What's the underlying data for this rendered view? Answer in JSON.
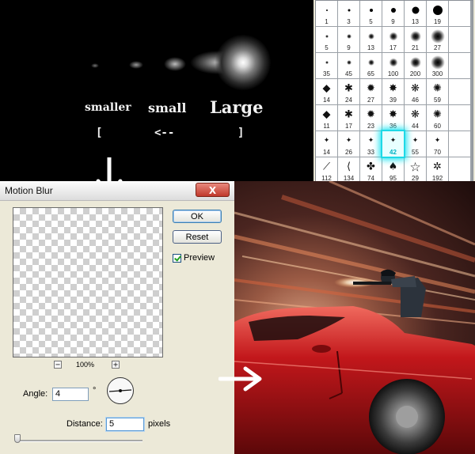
{
  "brush_tips": {
    "smaller_label": "smaller",
    "small_label": "small",
    "large_label": "Large",
    "key_open": "[",
    "key_arrow": "<--",
    "key_close": "]"
  },
  "brush_picker": {
    "selected": "42",
    "rows": [
      [
        "1",
        "3",
        "5",
        "9",
        "13",
        "19"
      ],
      [
        "5",
        "9",
        "13",
        "17",
        "21",
        "27"
      ],
      [
        "35",
        "45",
        "65",
        "100",
        "200",
        "300"
      ],
      [
        "14",
        "24",
        "27",
        "39",
        "46",
        "59"
      ],
      [
        "11",
        "17",
        "23",
        "36",
        "44",
        "60"
      ],
      [
        "14",
        "26",
        "33",
        "42",
        "55",
        "70"
      ],
      [
        "112",
        "134",
        "74",
        "95",
        "29",
        "192"
      ]
    ]
  },
  "dialog": {
    "title": "Motion Blur",
    "close_symbol": "X",
    "ok_label": "OK",
    "reset_label": "Reset",
    "preview_label": "Preview",
    "preview_checked": true,
    "zoom_out_symbol": "−",
    "zoom_in_symbol": "+",
    "zoom_level": "100%",
    "angle_label": "Angle:",
    "angle_value": "4",
    "angle_unit": "°",
    "distance_label": "Distance:",
    "distance_value": "5",
    "distance_unit": "pixels"
  },
  "colors": {
    "selection_glow": "#1fd9e6",
    "car_red": "#c2171b",
    "dialog_bg": "#ece9d8"
  },
  "icons": {
    "down_arrow": "white-arrow-down-icon",
    "right_arrow": "white-arrow-right-icon"
  }
}
